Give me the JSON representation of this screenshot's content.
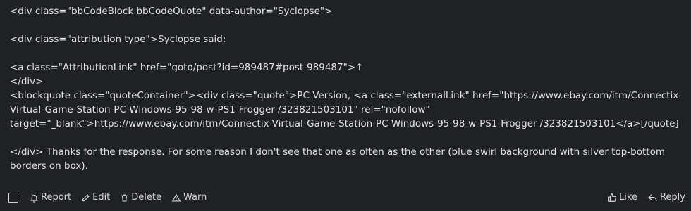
{
  "post": {
    "lines": [
      "<div class=\"bbCodeBlock bbCodeQuote\" data-author=\"Syclopse\">",
      "<div class=\"attribution type\">Syclopse said:",
      "<a class=\"AttributionLink\" href=\"goto/post?id=989487#post-989487\">↑",
      "</div>",
      "<blockquote class=\"quoteContainer\"><div class=\"quote\">PC Version, <a class=\"externalLink\" href=\"https://www.ebay.com/itm/Connectix-Virtual-Game-Station-PC-Windows-95-98-w-PS1-Frogger-/323821503101\" rel=\"nofollow\" target=\"_blank\">https://www.ebay.com/itm/Connectix-Virtual-Game-Station-PC-Windows-95-98-w-PS1-Frogger-/323821503101</a>[/quote]",
      "</div> Thanks for the response. For some reason I don't see that one as often as the other (blue swirl background with silver top-bottom borders on box)."
    ]
  },
  "actions": {
    "report": "Report",
    "edit": "Edit",
    "delete": "Delete",
    "warn": "Warn",
    "like": "Like",
    "reply": "Reply"
  }
}
